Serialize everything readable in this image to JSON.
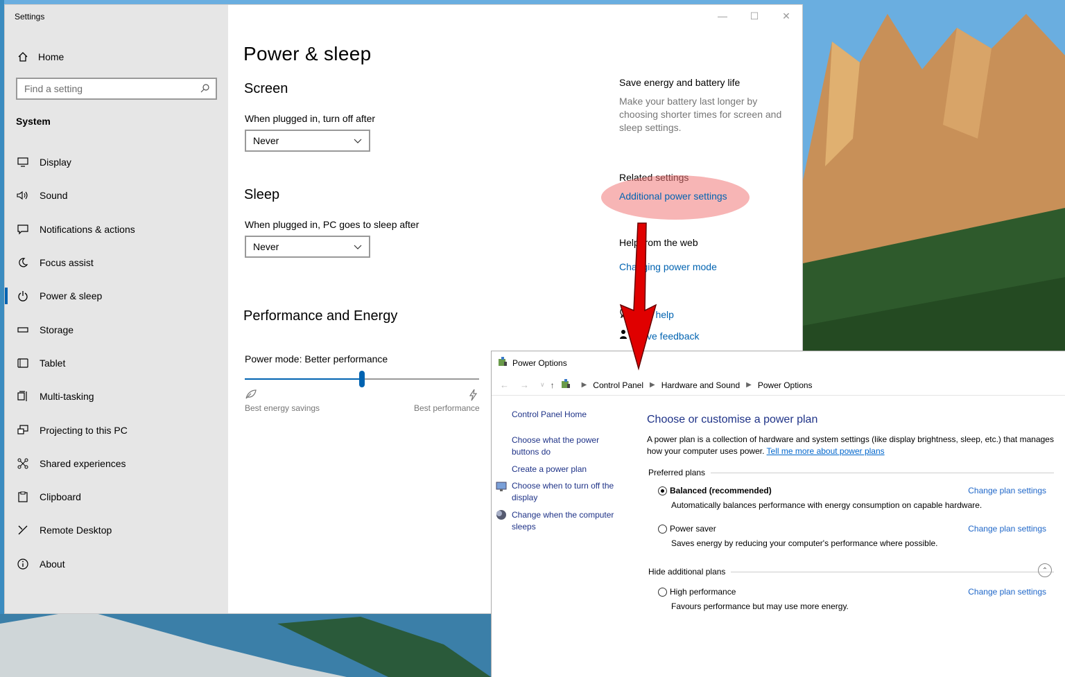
{
  "settings": {
    "window_title": "Settings",
    "home_label": "Home",
    "search_placeholder": "Find a setting",
    "section": "System",
    "nav": [
      {
        "label": "Display",
        "icon": "display-icon"
      },
      {
        "label": "Sound",
        "icon": "sound-icon"
      },
      {
        "label": "Notifications & actions",
        "icon": "notifications-icon"
      },
      {
        "label": "Focus assist",
        "icon": "moon-icon"
      },
      {
        "label": "Power & sleep",
        "icon": "power-icon",
        "active": true
      },
      {
        "label": "Storage",
        "icon": "storage-icon"
      },
      {
        "label": "Tablet",
        "icon": "tablet-icon"
      },
      {
        "label": "Multi-tasking",
        "icon": "multitasking-icon"
      },
      {
        "label": "Projecting to this PC",
        "icon": "projecting-icon"
      },
      {
        "label": "Shared experiences",
        "icon": "shared-icon"
      },
      {
        "label": "Clipboard",
        "icon": "clipboard-icon"
      },
      {
        "label": "Remote Desktop",
        "icon": "remote-desktop-icon"
      },
      {
        "label": "About",
        "icon": "info-icon"
      }
    ],
    "page_title": "Power & sleep",
    "screen": {
      "heading": "Screen",
      "label": "When plugged in, turn off after",
      "value": "Never"
    },
    "sleep": {
      "heading": "Sleep",
      "label": "When plugged in, PC goes to sleep after",
      "value": "Never"
    },
    "performance": {
      "heading": "Performance and Energy",
      "power_mode_label": "Power mode: Better performance",
      "slider_position": 0.5,
      "min_label": "Best energy savings",
      "max_label": "Best performance"
    },
    "right": {
      "save_title": "Save energy and battery life",
      "save_text": "Make your battery last longer by choosing shorter times for screen and sleep settings.",
      "related_title": "Related settings",
      "related_link": "Additional power settings",
      "help_title": "Help from the web",
      "help_link": "Changing power mode",
      "get_help": "Get help",
      "give_feedback": "Give feedback"
    },
    "accent_color": "#0063b1"
  },
  "power_options": {
    "window_title": "Power Options",
    "breadcrumb": [
      "Control Panel",
      "Hardware and Sound",
      "Power Options"
    ],
    "left_links": [
      "Control Panel Home",
      "Choose what the power buttons do",
      "Create a power plan",
      "Choose when to turn off the display",
      "Change when the computer sleeps"
    ],
    "heading": "Choose or customise a power plan",
    "description": "A power plan is a collection of hardware and system settings (like display brightness, sleep, etc.) that manages how your computer uses power.",
    "description_link": "Tell me more about power plans",
    "preferred_plans_label": "Preferred plans",
    "hide_additional_label": "Hide additional plans",
    "change_label": "Change plan settings",
    "plans": [
      {
        "name": "Balanced (recommended)",
        "desc": "Automatically balances performance with energy consumption on capable hardware.",
        "selected": true
      },
      {
        "name": "Power saver",
        "desc": "Saves energy by reducing your computer's performance where possible.",
        "selected": false
      },
      {
        "name": "High performance",
        "desc": "Favours performance but may use more energy.",
        "selected": false
      }
    ]
  },
  "annotation": {
    "highlight_color": "#f07878",
    "arrow_color": "#e00000"
  }
}
